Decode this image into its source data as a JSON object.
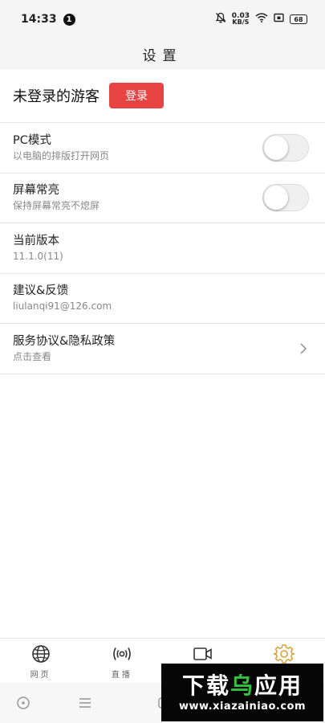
{
  "status_bar": {
    "time": "14:33",
    "notification_count": "1",
    "net_speed_value": "0.03",
    "net_speed_unit": "KB/S",
    "battery": "68"
  },
  "header": {
    "title": "设置"
  },
  "account": {
    "guest_label": "未登录的游客",
    "login_label": "登录"
  },
  "settings": [
    {
      "title": "PC模式",
      "subtitle": "以电脑的排版打开网页",
      "control": "toggle",
      "on": false
    },
    {
      "title": "屏幕常亮",
      "subtitle": "保持屏幕常亮不熄屏",
      "control": "toggle",
      "on": false
    },
    {
      "title": "当前版本",
      "subtitle": "11.1.0(11)"
    },
    {
      "title": "建议&反馈",
      "subtitle": "liulanqi91@126.com"
    },
    {
      "title": "服务协议&隐私政策",
      "subtitle": "点击查看",
      "control": "chevron"
    }
  ],
  "bottom_nav": [
    {
      "label": "网页",
      "icon": "globe-icon"
    },
    {
      "label": "直播",
      "icon": "broadcast-icon"
    },
    {
      "label": "",
      "icon": "video-camera-icon"
    },
    {
      "label": "",
      "icon": "gear-icon",
      "active": true
    }
  ],
  "watermark": {
    "brand_white": "下载",
    "brand_green": "乌",
    "brand_rest": "应用",
    "url": "www.xiazainiao.com"
  },
  "colors": {
    "accent": "#e84343",
    "active_tab": "#d9a335",
    "watermark_green": "#34c23e"
  }
}
